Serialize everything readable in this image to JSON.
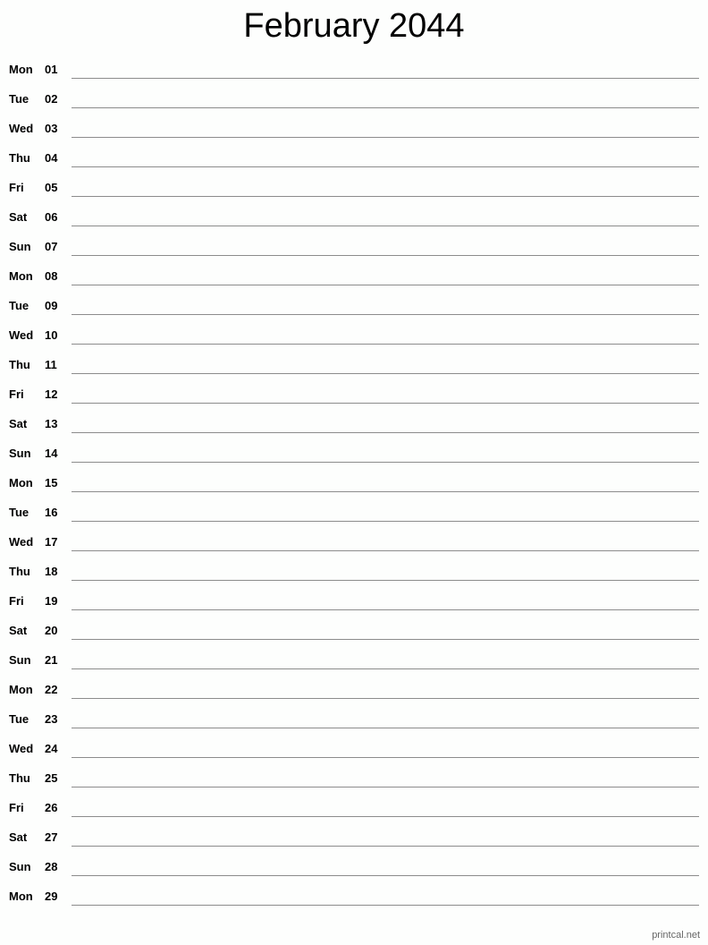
{
  "title": "February 2044",
  "days": [
    {
      "dow": "Mon",
      "day": "01"
    },
    {
      "dow": "Tue",
      "day": "02"
    },
    {
      "dow": "Wed",
      "day": "03"
    },
    {
      "dow": "Thu",
      "day": "04"
    },
    {
      "dow": "Fri",
      "day": "05"
    },
    {
      "dow": "Sat",
      "day": "06"
    },
    {
      "dow": "Sun",
      "day": "07"
    },
    {
      "dow": "Mon",
      "day": "08"
    },
    {
      "dow": "Tue",
      "day": "09"
    },
    {
      "dow": "Wed",
      "day": "10"
    },
    {
      "dow": "Thu",
      "day": "11"
    },
    {
      "dow": "Fri",
      "day": "12"
    },
    {
      "dow": "Sat",
      "day": "13"
    },
    {
      "dow": "Sun",
      "day": "14"
    },
    {
      "dow": "Mon",
      "day": "15"
    },
    {
      "dow": "Tue",
      "day": "16"
    },
    {
      "dow": "Wed",
      "day": "17"
    },
    {
      "dow": "Thu",
      "day": "18"
    },
    {
      "dow": "Fri",
      "day": "19"
    },
    {
      "dow": "Sat",
      "day": "20"
    },
    {
      "dow": "Sun",
      "day": "21"
    },
    {
      "dow": "Mon",
      "day": "22"
    },
    {
      "dow": "Tue",
      "day": "23"
    },
    {
      "dow": "Wed",
      "day": "24"
    },
    {
      "dow": "Thu",
      "day": "25"
    },
    {
      "dow": "Fri",
      "day": "26"
    },
    {
      "dow": "Sat",
      "day": "27"
    },
    {
      "dow": "Sun",
      "day": "28"
    },
    {
      "dow": "Mon",
      "day": "29"
    }
  ],
  "footer": "printcal.net"
}
